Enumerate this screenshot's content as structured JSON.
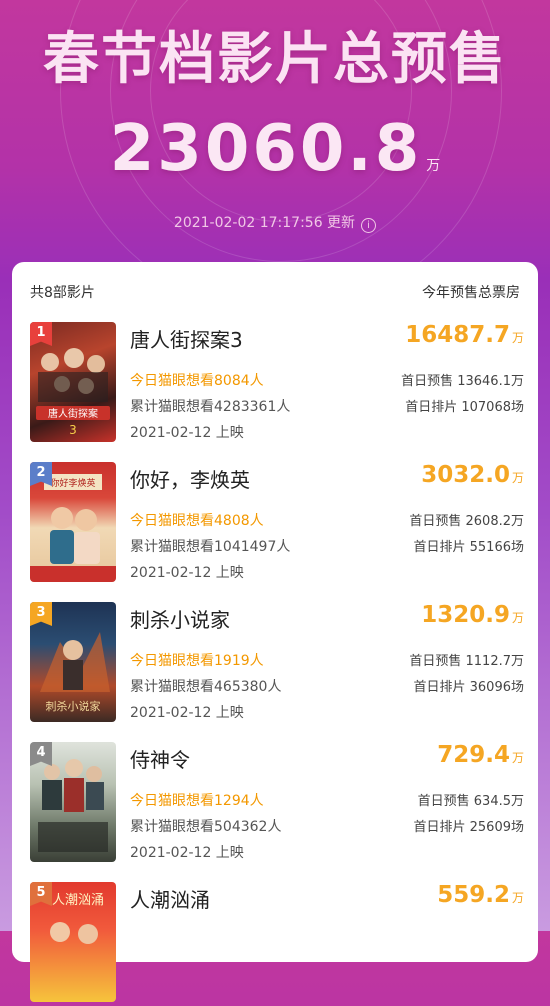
{
  "header": {
    "title": "春节档影片总预售",
    "total_value": "23060.8",
    "total_unit": "万",
    "update_time": "2021-02-02 17:17:56 更新",
    "info_icon": "i"
  },
  "card": {
    "count_label": "共8部影片",
    "column_label": "今年预售总票房"
  },
  "colors": {
    "rank1": "#e8403c",
    "rank2": "#5b7ec9",
    "rank3": "#f5a623",
    "rank4": "#8a8a8a",
    "rank5": "#e0703c",
    "accent": "#f5a623"
  },
  "movies": [
    {
      "rank": "1",
      "title": "唐人街探案3",
      "box": "16487.7",
      "unit": "万",
      "want_today": "今日猫眼想看8084人",
      "want_total": "累计猫眼想看4283361人",
      "release": "2021-02-12 上映",
      "first_day_presale": "首日预售 13646.1万",
      "first_day_shows": "首日排片 107068场",
      "poster_text": "唐人街探案"
    },
    {
      "rank": "2",
      "title": "你好，李焕英",
      "box": "3032.0",
      "unit": "万",
      "want_today": "今日猫眼想看4808人",
      "want_total": "累计猫眼想看1041497人",
      "release": "2021-02-12 上映",
      "first_day_presale": "首日预售 2608.2万",
      "first_day_shows": "首日排片 55166场",
      "poster_text": "你好李焕英"
    },
    {
      "rank": "3",
      "title": "刺杀小说家",
      "box": "1320.9",
      "unit": "万",
      "want_today": "今日猫眼想看1919人",
      "want_total": "累计猫眼想看465380人",
      "release": "2021-02-12 上映",
      "first_day_presale": "首日预售 1112.7万",
      "first_day_shows": "首日排片 36096场",
      "poster_text": "刺杀小说家"
    },
    {
      "rank": "4",
      "title": "侍神令",
      "box": "729.4",
      "unit": "万",
      "want_today": "今日猫眼想看1294人",
      "want_total": "累计猫眼想看504362人",
      "release": "2021-02-12 上映",
      "first_day_presale": "首日预售 634.5万",
      "first_day_shows": "首日排片 25609场",
      "poster_text": ""
    },
    {
      "rank": "5",
      "title": "人潮汹涌",
      "box": "559.2",
      "unit": "万",
      "want_today": "",
      "want_total": "",
      "release": "",
      "first_day_presale": "",
      "first_day_shows": "",
      "poster_text": "人潮汹涌"
    }
  ]
}
